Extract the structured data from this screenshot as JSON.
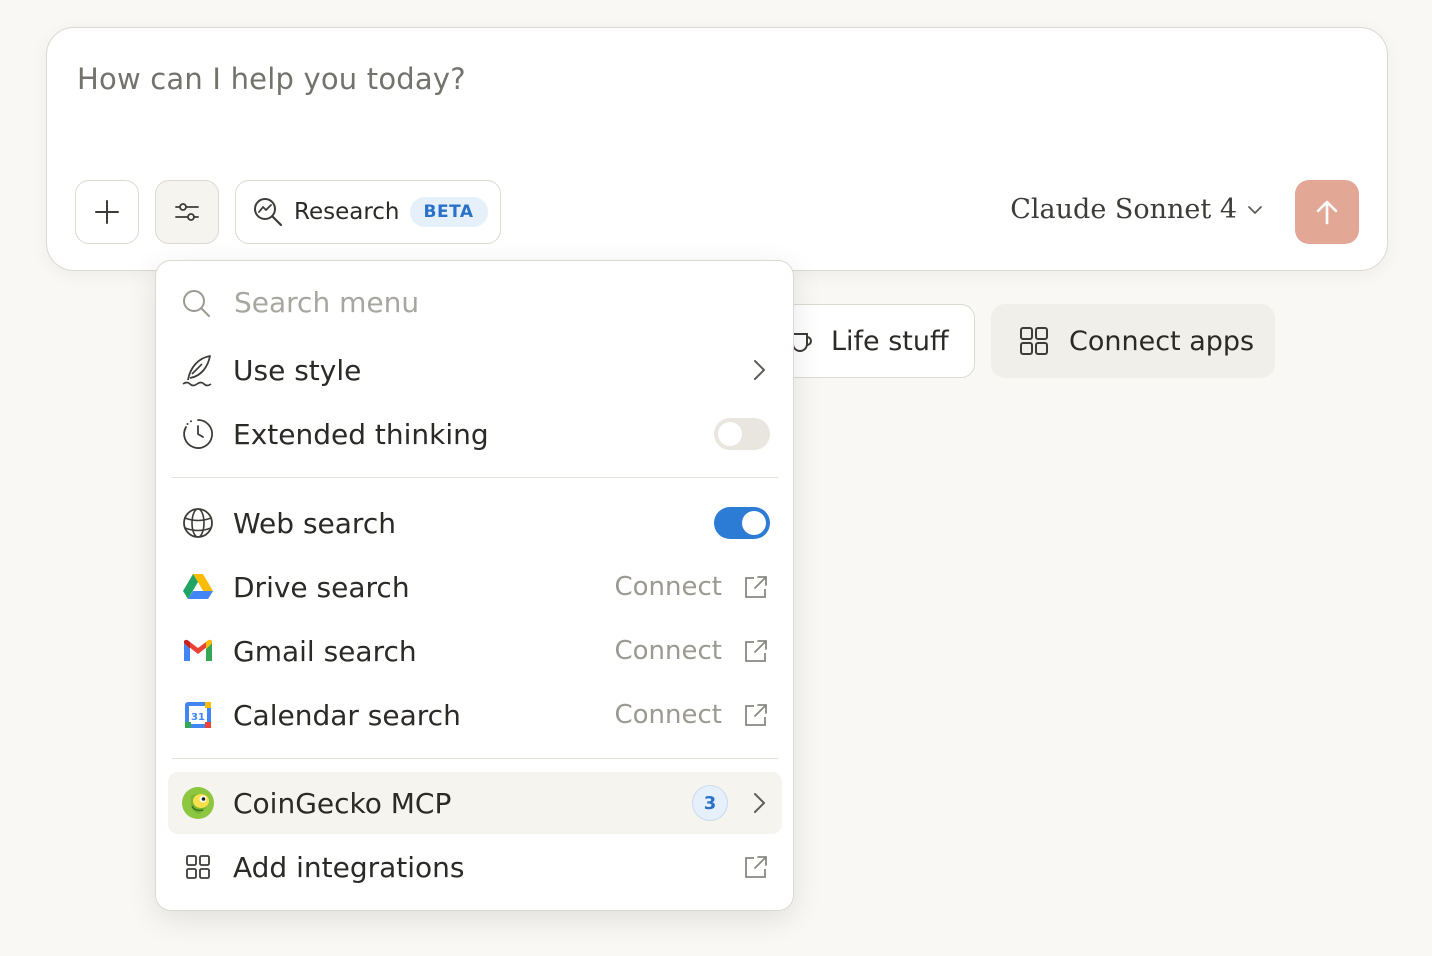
{
  "composer": {
    "placeholder": "How can I help you today?",
    "research_label": "Research",
    "beta_label": "BETA",
    "model_name": "Claude Sonnet 4"
  },
  "chips": {
    "life_stuff": "Life stuff",
    "connect_apps": "Connect apps"
  },
  "menu": {
    "search_placeholder": "Search menu",
    "items": [
      {
        "label": "Use style",
        "icon": "feather-icon",
        "right": "chevron"
      },
      {
        "label": "Extended thinking",
        "icon": "clock-icon",
        "right": "toggle",
        "enabled": false
      },
      {
        "label": "Web search",
        "icon": "globe-icon",
        "right": "toggle",
        "enabled": true
      },
      {
        "label": "Drive search",
        "icon": "google-drive-icon",
        "right": "connect",
        "action": "Connect"
      },
      {
        "label": "Gmail search",
        "icon": "gmail-icon",
        "right": "connect",
        "action": "Connect"
      },
      {
        "label": "Calendar search",
        "icon": "google-calendar-icon",
        "right": "connect",
        "action": "Connect"
      },
      {
        "label": "CoinGecko MCP",
        "icon": "coingecko-icon",
        "right": "count",
        "count": "3"
      },
      {
        "label": "Add integrations",
        "icon": "grid-icon",
        "right": "external"
      }
    ],
    "calendar_day": "31"
  },
  "colors": {
    "accent_blue": "#2c7cd6",
    "send_button": "#e3a795",
    "background": "#f9f8f5"
  }
}
